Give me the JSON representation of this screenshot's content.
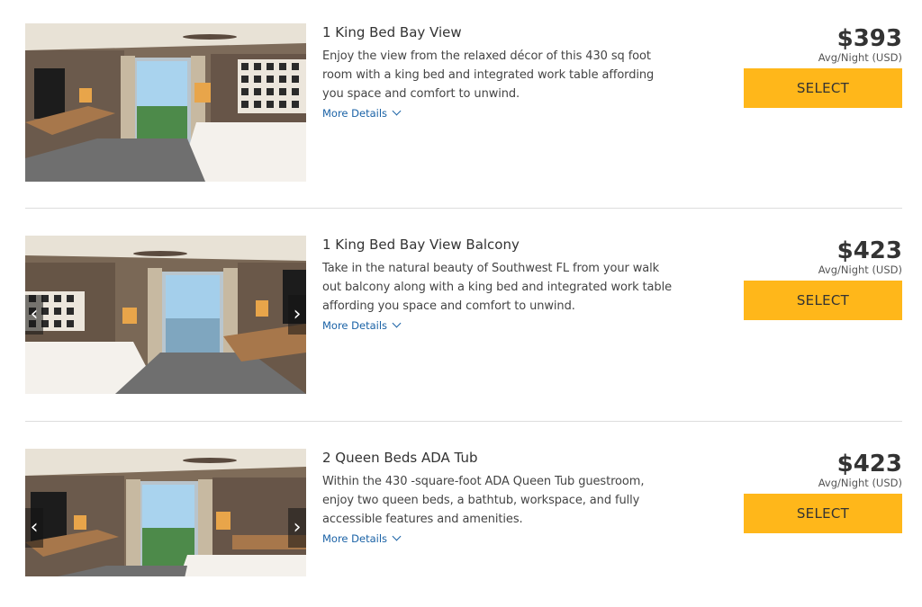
{
  "rooms": [
    {
      "title": "1 King Bed Bay View",
      "description": "Enjoy the view from the relaxed décor of this 430 sq foot room with a king bed and integrated work table affording you space and comfort to unwind.",
      "more_details": "More Details",
      "price": "$393",
      "per_night": "Avg/Night (USD)",
      "select_label": "SELECT",
      "has_carousel_arrows": false
    },
    {
      "title": "1 King Bed Bay View Balcony",
      "description": "Take in the natural beauty of Southwest FL from your walk out balcony along with a king bed and integrated work table affording you space and comfort to unwind.",
      "more_details": "More Details",
      "price": "$423",
      "per_night": "Avg/Night (USD)",
      "select_label": "SELECT",
      "has_carousel_arrows": true
    },
    {
      "title": "2 Queen Beds ADA Tub",
      "description": "Within the 430 -square-foot ADA Queen Tub guestroom, enjoy two queen beds, a bathtub, workspace, and fully accessible features and amenities.",
      "more_details": "More Details",
      "price": "$423",
      "per_night": "Avg/Night (USD)",
      "select_label": "SELECT",
      "has_carousel_arrows": true
    }
  ],
  "icons": {
    "prev": "chevron-left-icon",
    "next": "chevron-right-icon",
    "expand": "chevron-down-icon"
  },
  "colors": {
    "select_button": "#ffb71a",
    "link": "#1a62a6",
    "divider": "#dddddd"
  }
}
